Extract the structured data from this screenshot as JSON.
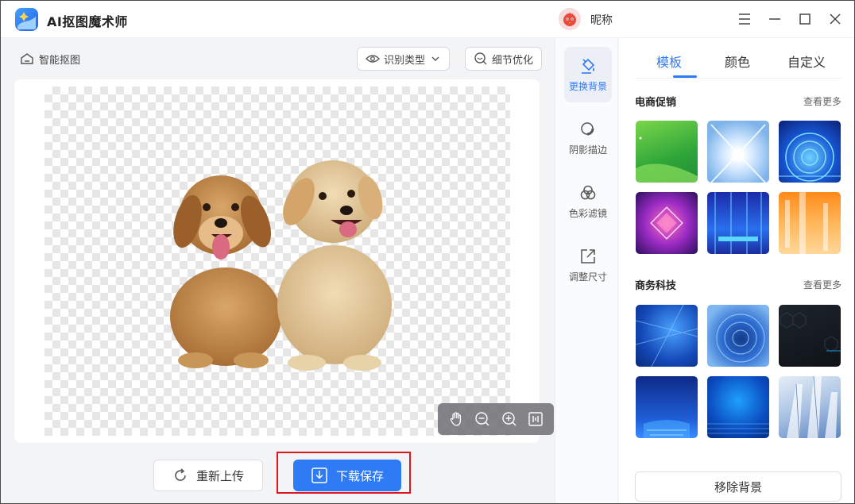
{
  "app": {
    "title": "AI抠图魔术师",
    "username": "昵称"
  },
  "toolbar": {
    "breadcrumb": "智能抠图",
    "recognize_type": "识别类型",
    "refine": "细节优化"
  },
  "actions": {
    "reupload": "重新上传",
    "download": "下载保存",
    "remove_bg": "移除背景"
  },
  "side_tools": [
    {
      "label": "更换背景",
      "icon": "paint-bucket-icon",
      "active": true
    },
    {
      "label": "阴影描边",
      "icon": "shadow-stroke-icon",
      "active": false
    },
    {
      "label": "色彩滤镜",
      "icon": "color-filter-icon",
      "active": false
    },
    {
      "label": "调整尺寸",
      "icon": "resize-icon",
      "active": false
    }
  ],
  "tabs": [
    {
      "label": "模板",
      "active": true
    },
    {
      "label": "颜色",
      "active": false
    },
    {
      "label": "自定义",
      "active": false
    }
  ],
  "sections": [
    {
      "title": "电商促销",
      "more": "查看更多"
    },
    {
      "title": "商务科技",
      "more": "查看更多"
    }
  ],
  "colors": {
    "accent": "#2f7bf5",
    "highlight_frame": "#e0141e"
  },
  "zoom_controls": [
    "hand-icon",
    "zoom-out-icon",
    "zoom-in-icon",
    "fit-icon"
  ]
}
